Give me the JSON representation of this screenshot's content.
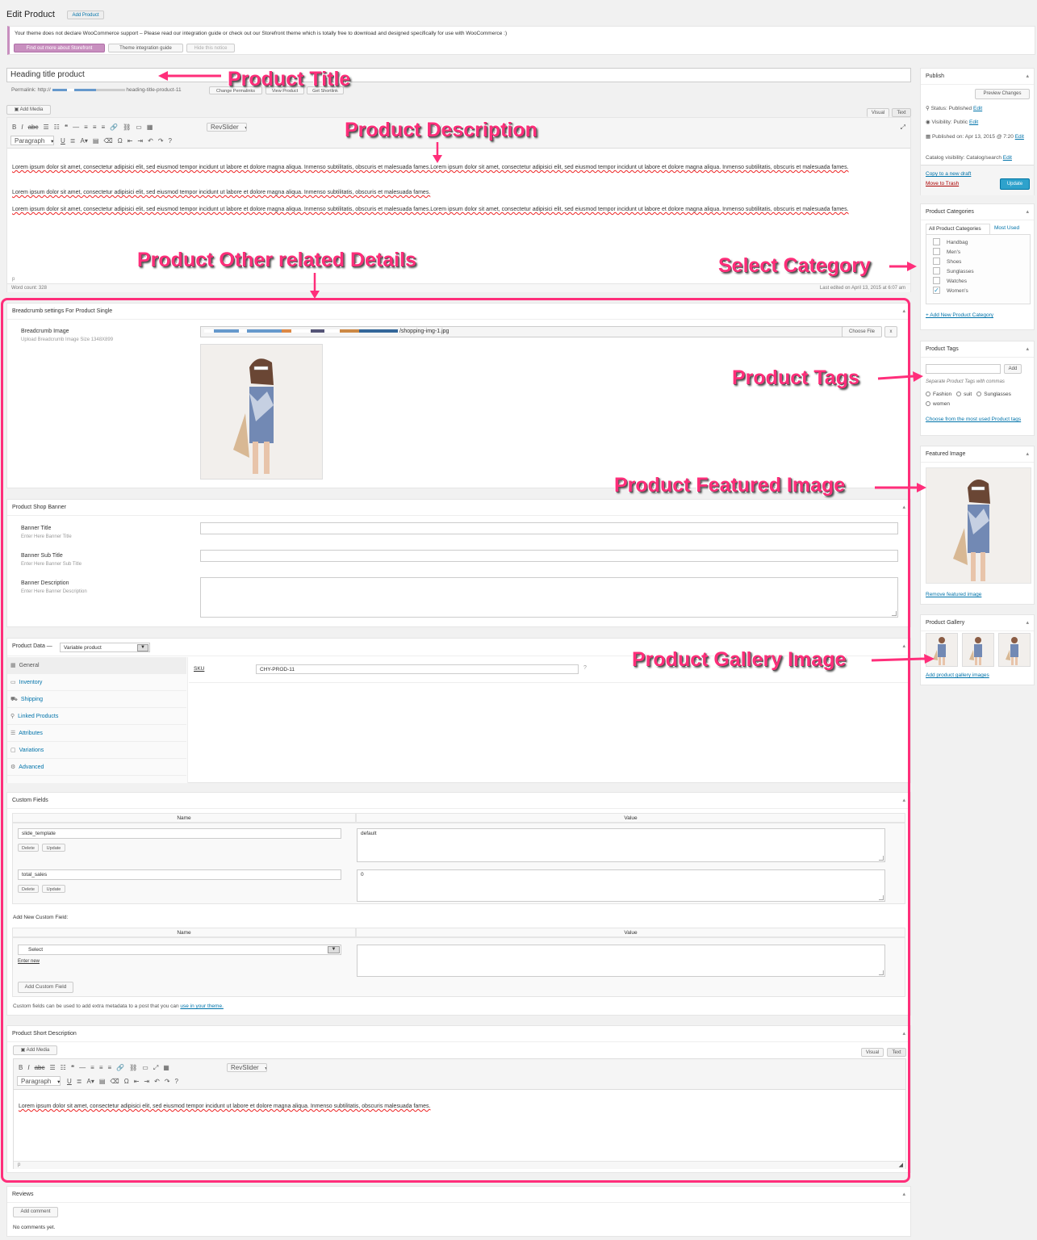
{
  "header": {
    "title": "Edit Product",
    "add_button": "Add Product"
  },
  "notice": {
    "text": "Your theme does not declare WooCommerce support – Please read our integration guide or check out our Storefront theme which is totally free to download and designed specifically for use with WooCommerce :)",
    "btn_storefront": "Find out more about Storefront",
    "btn_guide": "Theme integration guide",
    "btn_hide": "Hide this notice"
  },
  "title_input": {
    "value": "Heading title product"
  },
  "permalink": {
    "label": "Permalink:",
    "prefix": "http://",
    "slug": "heading-title-product-11",
    "change_btn": "Change Permalinks",
    "view_btn": "View Product",
    "shortlink_btn": "Get Shortlink"
  },
  "editor": {
    "add_media": "Add Media",
    "tab_visual": "Visual",
    "tab_text": "Text",
    "format_select": "Paragraph",
    "revslider": "RevSlider",
    "paragraphs": [
      "Lorem ipsum dolor sit amet, consectetur adipisici elit, sed eiusmod tempor incidunt ut labore et dolore magna aliqua. Inmenso subtilitatis, obscuris et malesuada fames.Lorem ipsum dolor sit amet, consectetur adipisici elit, sed eiusmod tempor incidunt ut labore et dolore magna aliqua. Inmenso subtilitatis, obscuris et malesuada fames.",
      "Lorem ipsum dolor sit amet, consectetur adipisici elit, sed eiusmod tempor incidunt ut labore et dolore magna aliqua. Inmenso subtilitatis, obscuris et malesuada fames.",
      "Lorem ipsum dolor sit amet, consectetur adipisici elit, sed eiusmod tempor incidunt ut labore et dolore magna aliqua. Inmenso subtilitatis, obscuris et malesuada fames.Lorem ipsum dolor sit amet, consectetur adipisici elit, sed eiusmod tempor incidunt ut labore et dolore magna aliqua. Inmenso subtilitatis, obscuris et malesuada fames."
    ],
    "path": "p",
    "word_count": "Word count: 328",
    "last_edited": "Last edited on April 13, 2015 at 6:07 am"
  },
  "breadcrumb_box": {
    "title": "Breadcrumb settings For Product Single",
    "label": "Breadcrumb Image",
    "desc": "Upload Breadcrumb Image Size 1348X899",
    "file_value": "/shopping-img-1.jpg",
    "choose_btn": "Choose File",
    "remove_btn": "x"
  },
  "shop_banner": {
    "title": "Product Shop Banner",
    "banner_title": "Banner Title",
    "banner_title_desc": "Enter Here Banner Title",
    "banner_sub": "Banner Sub Title",
    "banner_sub_desc": "Enter Here Banner Sub Title",
    "banner_desc": "Banner Description",
    "banner_desc_desc": "Enter Here Banner Description"
  },
  "product_data": {
    "title": "Product Data —",
    "type": "Variable product",
    "tabs": [
      "General",
      "Inventory",
      "Shipping",
      "Linked Products",
      "Attributes",
      "Variations",
      "Advanced"
    ],
    "sku_label": "SKU",
    "sku_value": "CHY-PROD-11"
  },
  "custom_fields": {
    "title": "Custom Fields",
    "col_name": "Name",
    "col_value": "Value",
    "rows": [
      {
        "name": "slide_template",
        "value": "default"
      },
      {
        "name": "total_sales",
        "value": "0"
      }
    ],
    "delete_btn": "Delete",
    "update_btn": "Update",
    "add_new_label": "Add New Custom Field:",
    "select_value": "Select",
    "enter_new": "Enter new",
    "add_btn": "Add Custom Field",
    "footer_note": "Custom fields can be used to add extra metadata to a post that you can ",
    "footer_link": "use in your theme."
  },
  "short_desc": {
    "title": "Product Short Description",
    "add_media": "Add Media",
    "tab_visual": "Visual",
    "tab_text": "Text",
    "format_select": "Paragraph",
    "revslider": "RevSlider",
    "text": "Lorem ipsum dolor sit amet, consectetur adipisici elit, sed eiusmod tempor incidunt ut labore et dolore magna aliqua. Inmenso subtilitatis, obscuris malesuada fames.",
    "path": "p"
  },
  "reviews": {
    "title": "Reviews",
    "add_btn": "Add comment",
    "none": "No comments yet."
  },
  "publish": {
    "title": "Publish",
    "preview_btn": "Preview Changes",
    "status": "Status: Published",
    "visibility": "Visibility: Public",
    "published_on": "Published on: Apr 13, 2015 @ 7:20",
    "catalog": "Catalog visibility: Catalog/search",
    "edit": "Edit",
    "copy_draft": "Copy to a new draft",
    "trash": "Move to Trash",
    "update_btn": "Update"
  },
  "categories": {
    "title": "Product Categories",
    "tab_all": "All Product Categories",
    "tab_most": "Most Used",
    "items": [
      {
        "label": "Handbag",
        "checked": false
      },
      {
        "label": "Men's",
        "checked": false
      },
      {
        "label": "Shoes",
        "checked": false
      },
      {
        "label": "Sunglasses",
        "checked": false
      },
      {
        "label": "Watches",
        "checked": false
      },
      {
        "label": "Women's",
        "checked": true
      }
    ],
    "add_new": "+ Add New Product Category"
  },
  "tags": {
    "title": "Product Tags",
    "add_btn": "Add",
    "hint": "Separate Product Tags with commas",
    "items": [
      "Fashion",
      "suit",
      "Sunglasses",
      "women"
    ],
    "choose": "Choose from the most used Product tags"
  },
  "featured": {
    "title": "Featured Image",
    "remove": "Remove featured image"
  },
  "gallery": {
    "title": "Product Gallery",
    "add": "Add product gallery images"
  },
  "annotations": {
    "title": "Product Title",
    "description": "Product Description",
    "other": "Product Other related Details",
    "category": "Select Category",
    "tags": "Product Tags",
    "featured": "Product Featured Image",
    "gallery": "Product Gallery Image"
  },
  "colors": {
    "accent": "#ff2e7a",
    "link": "#0073aa",
    "primary_btn": "#2ea2cc",
    "notice_btn": "#c88fbf"
  }
}
